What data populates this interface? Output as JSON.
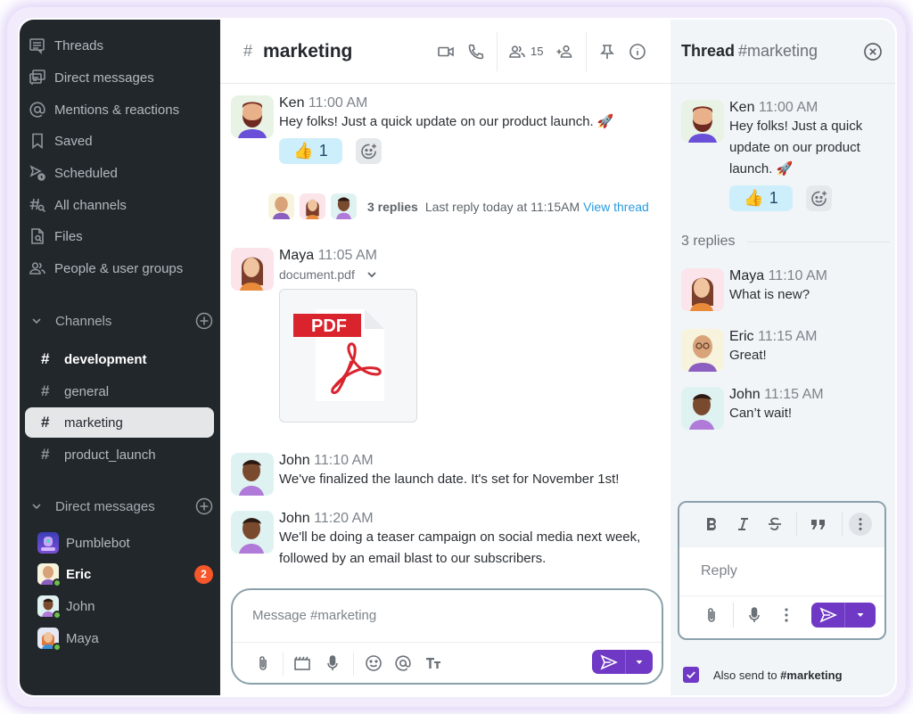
{
  "sidebar": {
    "nav": [
      {
        "label": "Threads",
        "icon": "threads-icon"
      },
      {
        "label": "Direct messages",
        "icon": "direct-messages-icon"
      },
      {
        "label": "Mentions & reactions",
        "icon": "at-icon"
      },
      {
        "label": "Saved",
        "icon": "bookmark-icon"
      },
      {
        "label": "Scheduled",
        "icon": "scheduled-icon"
      },
      {
        "label": "All channels",
        "icon": "channel-search-icon"
      },
      {
        "label": "Files",
        "icon": "file-search-icon"
      },
      {
        "label": "People & user groups",
        "icon": "people-icon"
      }
    ],
    "channels_header": "Channels",
    "channels": [
      {
        "name": "development",
        "unread": true,
        "active": false
      },
      {
        "name": "general",
        "unread": false,
        "active": false
      },
      {
        "name": "marketing",
        "unread": false,
        "active": true
      },
      {
        "name": "product_launch",
        "unread": false,
        "active": false
      }
    ],
    "dm_header": "Direct messages",
    "dms": [
      {
        "name": "Pumblebot",
        "online": false,
        "unread_count": null,
        "bold": false
      },
      {
        "name": "Eric",
        "online": true,
        "unread_count": "2",
        "bold": true
      },
      {
        "name": "John",
        "online": true,
        "unread_count": null,
        "bold": false
      },
      {
        "name": "Maya",
        "online": true,
        "unread_count": null,
        "bold": false
      }
    ]
  },
  "main": {
    "hash": "#",
    "channel": "marketing",
    "member_count": "15",
    "messages": [
      {
        "author": "Ken",
        "time": "11:00 AM",
        "text": "Hey folks! Just a quick update on our product launch. 🚀",
        "reaction_emoji": "👍",
        "reaction_count": "1"
      },
      {
        "author": "Maya",
        "time": "11:05 AM",
        "file_name": "document.pdf",
        "file_type_label": "PDF"
      },
      {
        "author": "John",
        "time": "11:10 AM",
        "text": "We've finalized the launch date. It's set for November 1st!"
      },
      {
        "author": "John",
        "time": "11:20 AM",
        "text": "We'll be doing a teaser campaign on social media next week, followed by an email blast to our subscribers."
      }
    ],
    "thread_summary": {
      "count": "3 replies",
      "last_reply": "Last reply today at 11:15AM",
      "view": "View thread"
    },
    "composer_placeholder": "Message #marketing"
  },
  "thread": {
    "title": "Thread",
    "channel": "#marketing",
    "root": {
      "author": "Ken",
      "time": "11:00 AM",
      "text": "Hey folks! Just a quick update on our product launch. 🚀",
      "reaction_emoji": "👍",
      "reaction_count": "1"
    },
    "replies_label": "3 replies",
    "replies": [
      {
        "author": "Maya",
        "time": "11:10 AM",
        "text": "What is new?"
      },
      {
        "author": "Eric",
        "time": "11:15 AM",
        "text": "Great!"
      },
      {
        "author": "John",
        "time": "11:15 AM",
        "text": "Can’t wait!"
      }
    ],
    "reply_placeholder": "Reply",
    "also_send_prefix": "Also send to",
    "also_send_channel": "#marketing",
    "also_send_checked": true
  },
  "colors": {
    "sidebar_bg": "#22272c",
    "accent_purple": "#6f38c5",
    "link_blue": "#2a9be0",
    "badge_orange": "#f5562a",
    "online_green": "#6cc04a",
    "reaction_bg": "#cdeffc"
  }
}
